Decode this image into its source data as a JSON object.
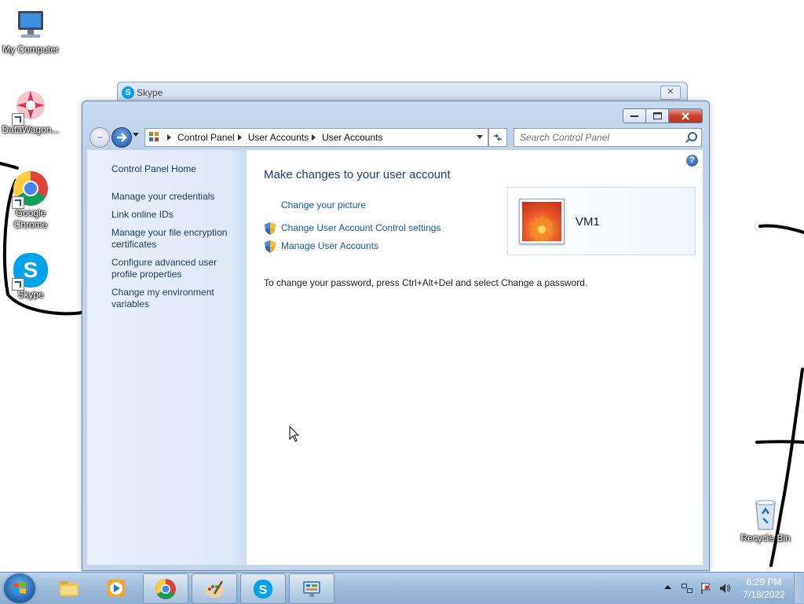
{
  "desktop": {
    "icons": [
      {
        "label": "My Computer",
        "icon": "computer-icon"
      },
      {
        "label": "DataWagon...",
        "icon": "datawagon-icon"
      },
      {
        "label": "Google Chrome",
        "icon": "chrome-icon"
      },
      {
        "label": "Skype",
        "icon": "skype-icon"
      },
      {
        "label": "Recycle Bin",
        "icon": "recycle-bin-icon"
      }
    ]
  },
  "skype_window": {
    "title": "Skype",
    "close_label": "✕"
  },
  "control_panel": {
    "breadcrumbs": [
      "Control Panel",
      "User Accounts",
      "User Accounts"
    ],
    "search_placeholder": "Search Control Panel",
    "help_label": "?",
    "left_pane": {
      "home": "Control Panel Home",
      "links": [
        "Manage your credentials",
        "Link online IDs",
        "Manage your file encryption certificates",
        "Configure advanced user profile properties",
        "Change my environment variables"
      ]
    },
    "main": {
      "title": "Make changes to your user account",
      "links": [
        {
          "label": "Change your picture",
          "shield": false
        },
        {
          "label": "Change User Account Control settings",
          "shield": true
        },
        {
          "label": "Manage User Accounts",
          "shield": true
        }
      ],
      "password_note": "To change your password, press Ctrl+Alt+Del and select Change a password.",
      "account_name": "VM1"
    }
  },
  "taskbar": {
    "pinned": [
      "explorer-icon",
      "media-player-icon",
      "chrome-icon",
      "paint-icon",
      "skype-icon",
      "control-panel-icon"
    ],
    "active": "control-panel-icon",
    "clock_time": "6:29 PM",
    "clock_date": "7/18/2022"
  },
  "colors": {
    "link": "#1a5aa0",
    "title": "#1e3f6d",
    "taskbar": "#9fbcda"
  }
}
